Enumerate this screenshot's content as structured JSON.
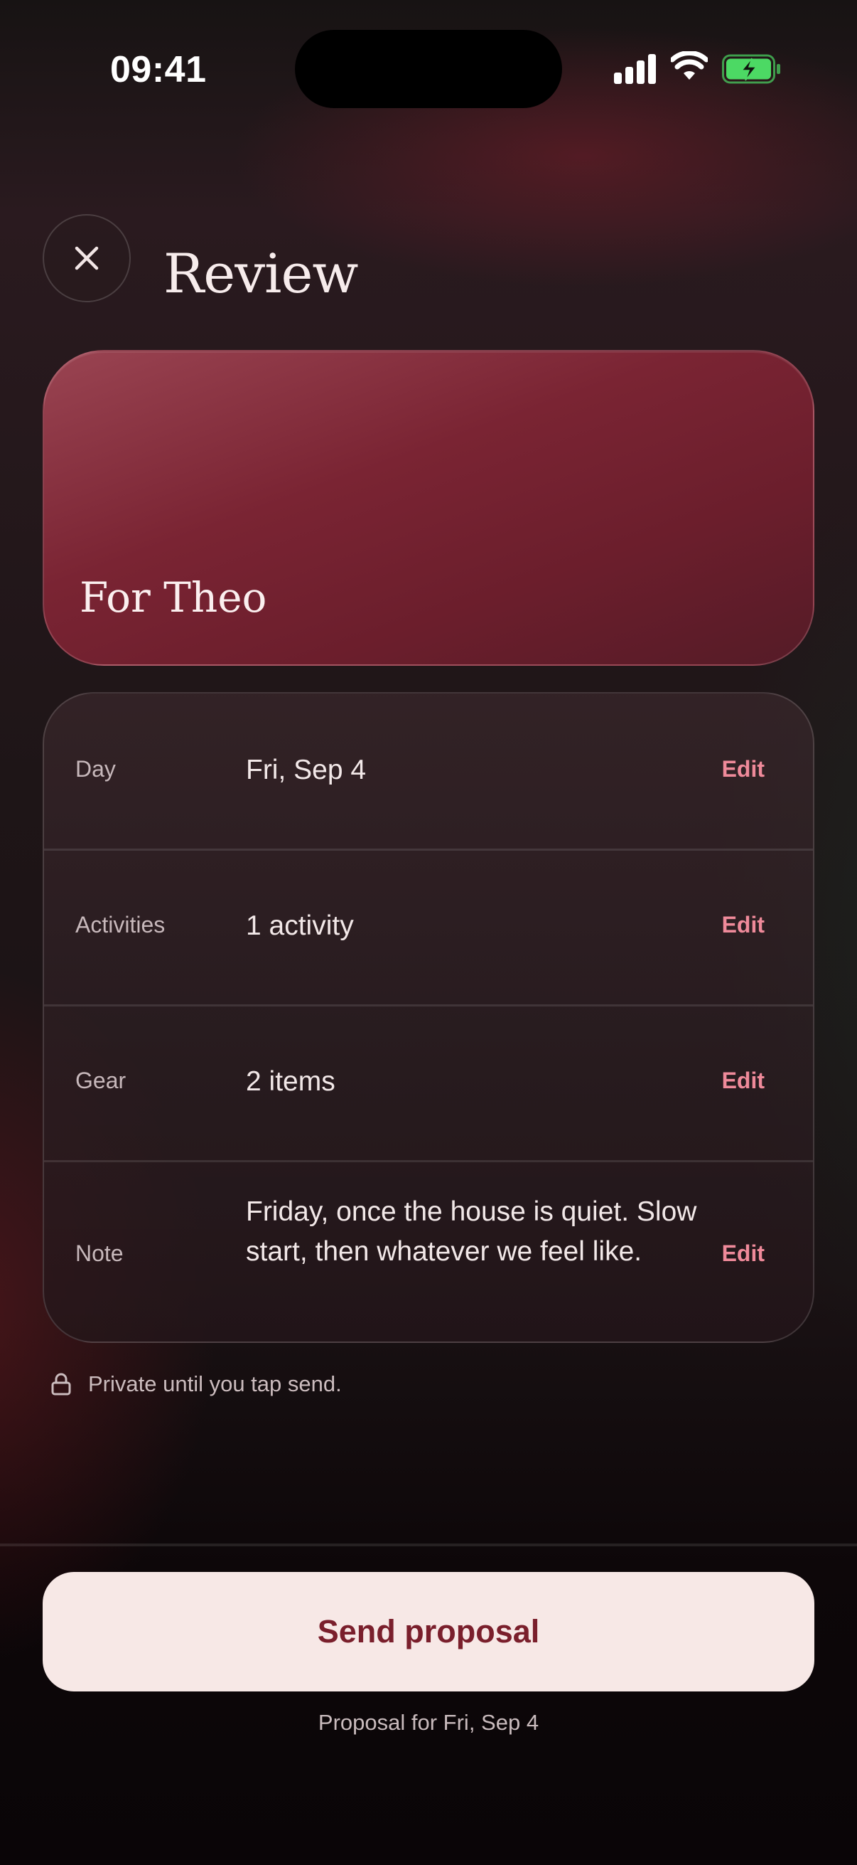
{
  "status_bar": {
    "time": "09:41",
    "icons": [
      "signal-icon",
      "wifi-icon",
      "battery-charging-icon"
    ],
    "battery_color": "#4cd964"
  },
  "header": {
    "close_icon": "close-icon",
    "title": "Review"
  },
  "hero": {
    "title": "For Theo",
    "color": "#7a2433"
  },
  "details": [
    {
      "label": "Day",
      "value": "Fri, Sep 4",
      "action": "Edit"
    },
    {
      "label": "Activities",
      "value": "1 activity",
      "action": "Edit"
    },
    {
      "label": "Gear",
      "value": "2 items",
      "action": "Edit"
    },
    {
      "label": "Note",
      "value": "Friday, once the house is quiet. Slow start, then whatever we feel like.",
      "action": "Edit"
    }
  ],
  "privacy": {
    "icon": "lock-icon",
    "text": "Private until you tap send."
  },
  "footer": {
    "send_label": "Send proposal",
    "note": "Proposal for Fri, Sep 4",
    "accent": "#7a1f2c"
  }
}
